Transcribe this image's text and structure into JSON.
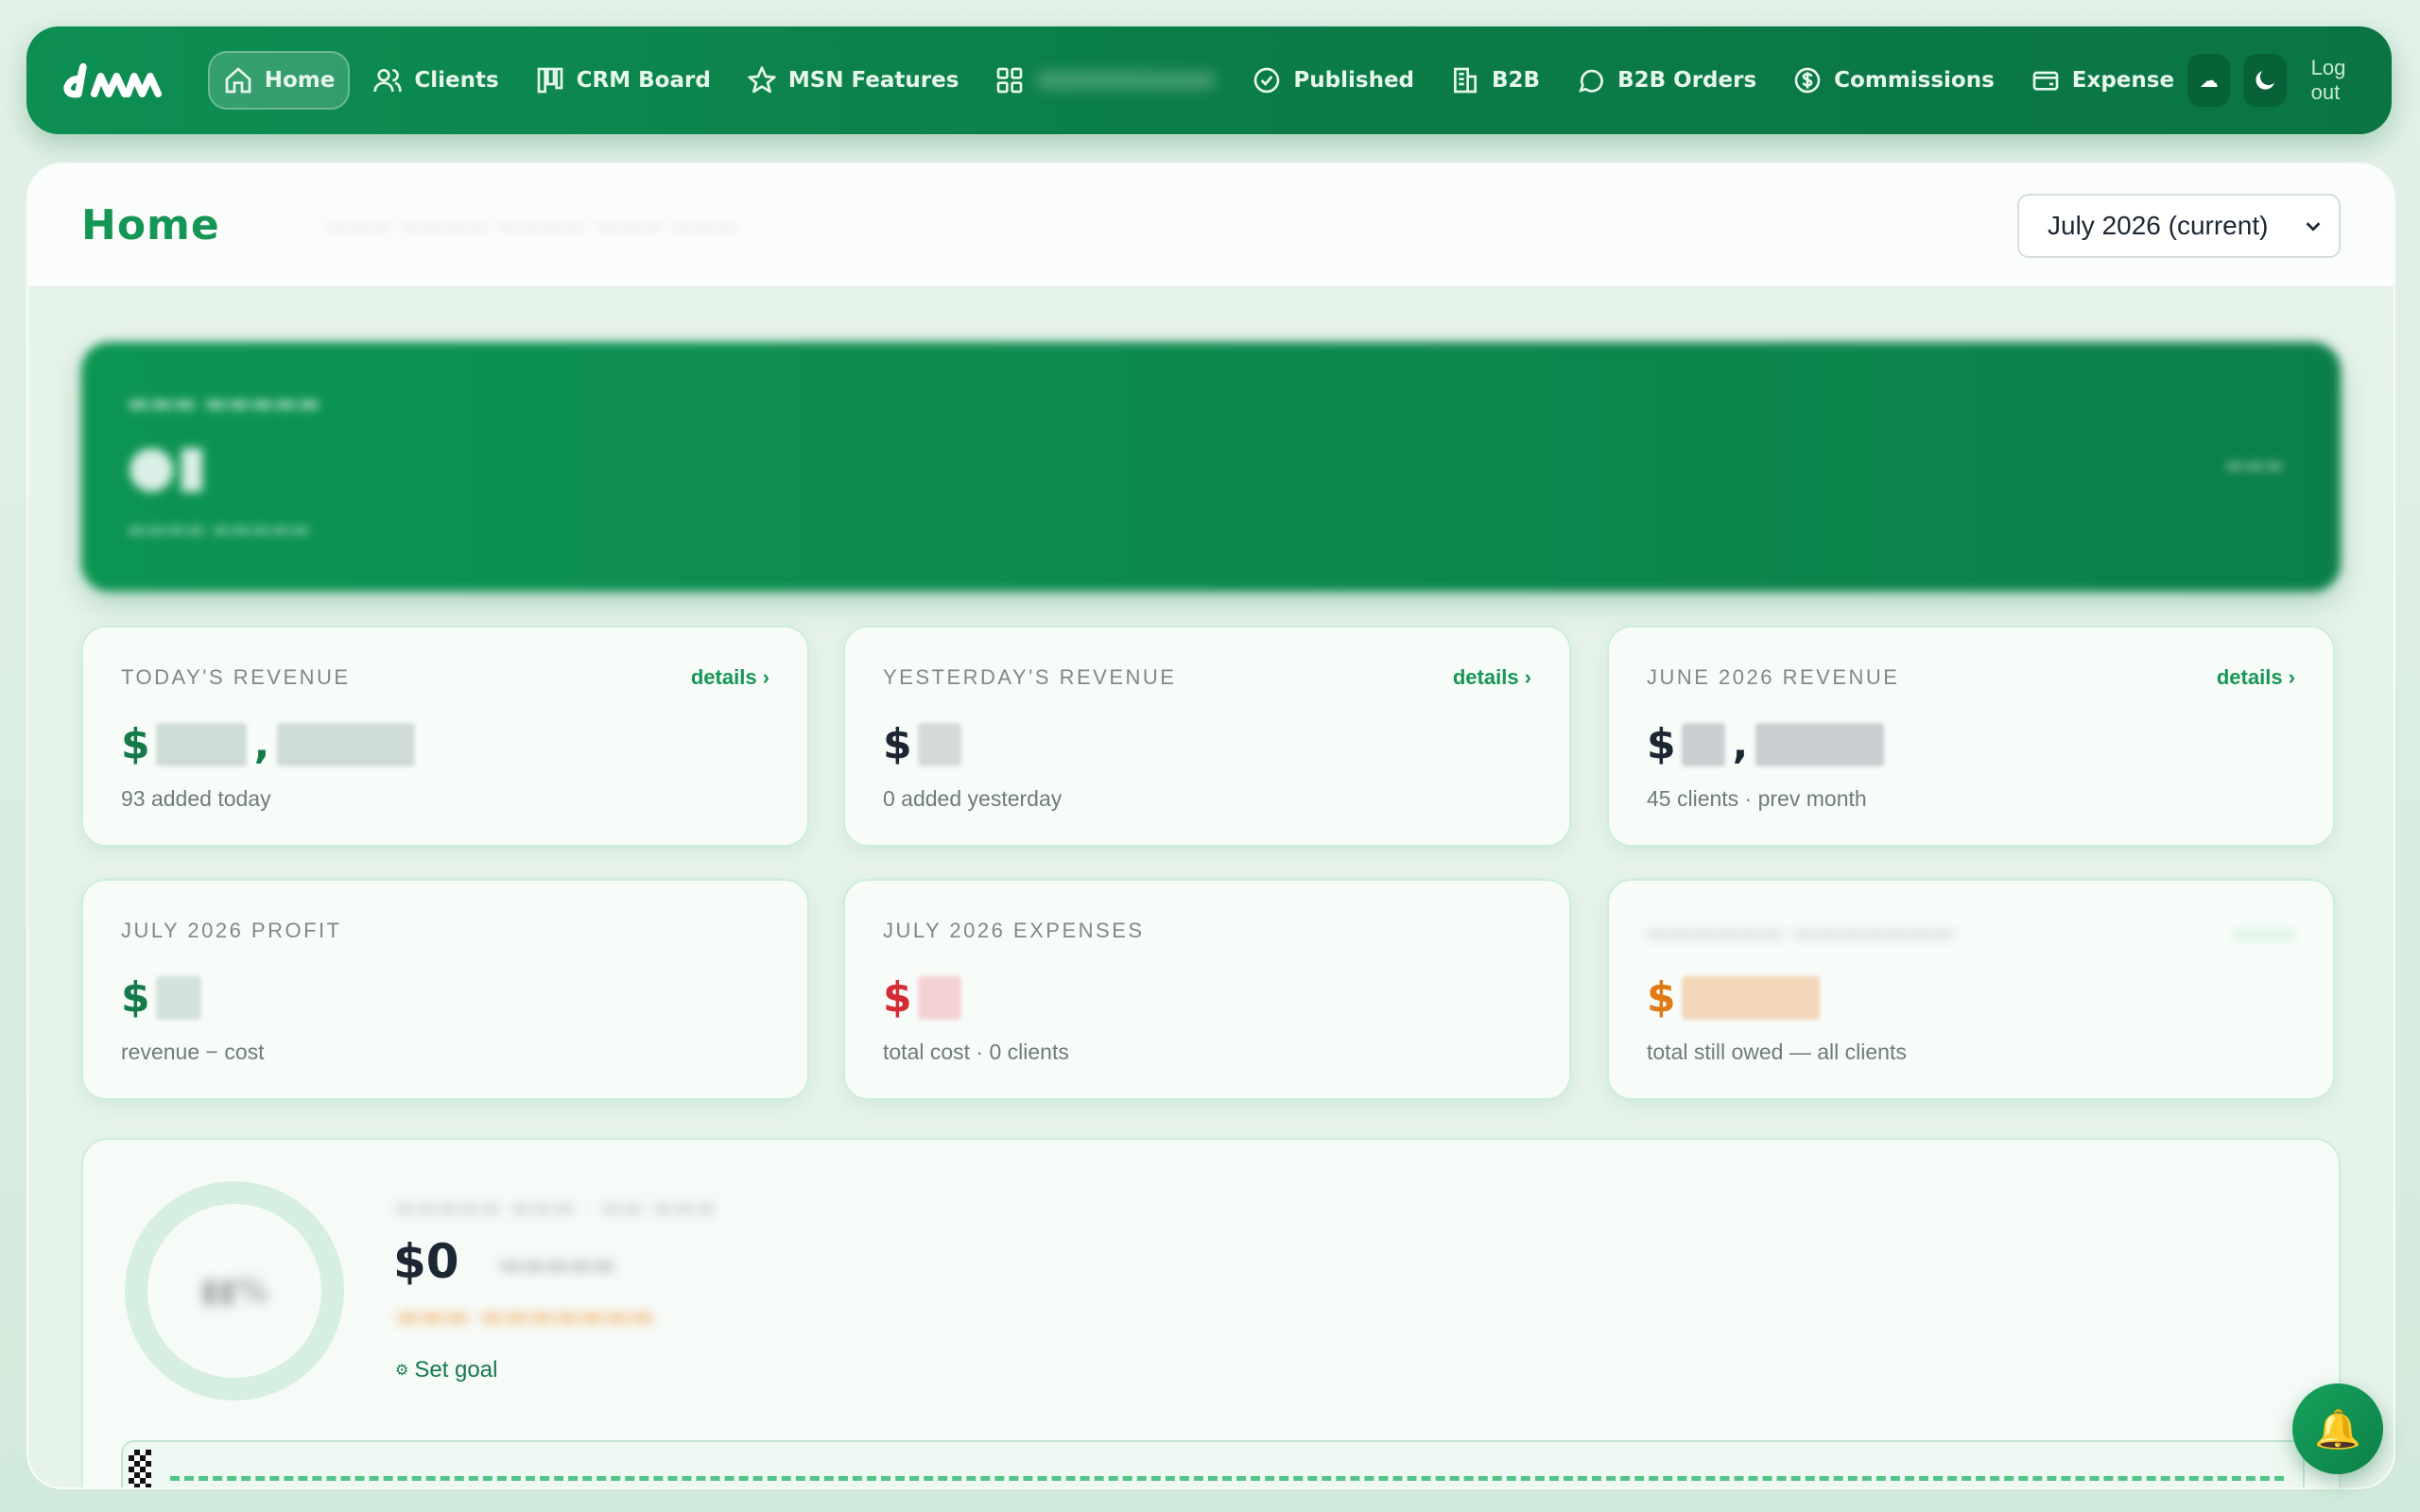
{
  "nav": {
    "logo_text": "dmn",
    "items": [
      {
        "label": "Home",
        "icon": "home-icon"
      },
      {
        "label": "Clients",
        "icon": "users-icon"
      },
      {
        "label": "CRM Board",
        "icon": "kanban-icon"
      },
      {
        "label": "MSN Features",
        "icon": "star-icon"
      },
      {
        "label": "",
        "icon": "grid-icon"
      },
      {
        "label": "Published",
        "icon": "check-circle-icon"
      },
      {
        "label": "B2B",
        "icon": "building-icon"
      },
      {
        "label": "B2B Orders",
        "icon": "chat-icon"
      },
      {
        "label": "Commissions",
        "icon": "dollar-circle-icon"
      },
      {
        "label": "Expense",
        "icon": "wallet-icon"
      }
    ],
    "logout_label": "Log out"
  },
  "header": {
    "title": "Home",
    "month_selector": "July 2026 (current)"
  },
  "cards": {
    "today": {
      "label": "TODAY'S REVENUE",
      "link": "details ›",
      "sub": "93 added today"
    },
    "yesterday": {
      "label": "YESTERDAY'S REVENUE",
      "link": "details ›",
      "sub": "0 added yesterday"
    },
    "june": {
      "label": "JUNE 2026 REVENUE",
      "link": "details ›",
      "sub": "45 clients · prev month"
    },
    "profit": {
      "label": "JULY 2026 PROFIT",
      "sub": "revenue − cost"
    },
    "expenses": {
      "label": "JULY 2026 EXPENSES",
      "sub": "total cost · 0 clients"
    },
    "owed": {
      "label": "",
      "sub": "total still owed — all clients"
    }
  },
  "goal": {
    "amount": "$0",
    "set_goal_label": "Set goal"
  },
  "colors": {
    "brand_green": "#0d8f52",
    "accent_green": "#169655",
    "expense_red": "#d52b34",
    "owed_orange": "#e07a14"
  }
}
